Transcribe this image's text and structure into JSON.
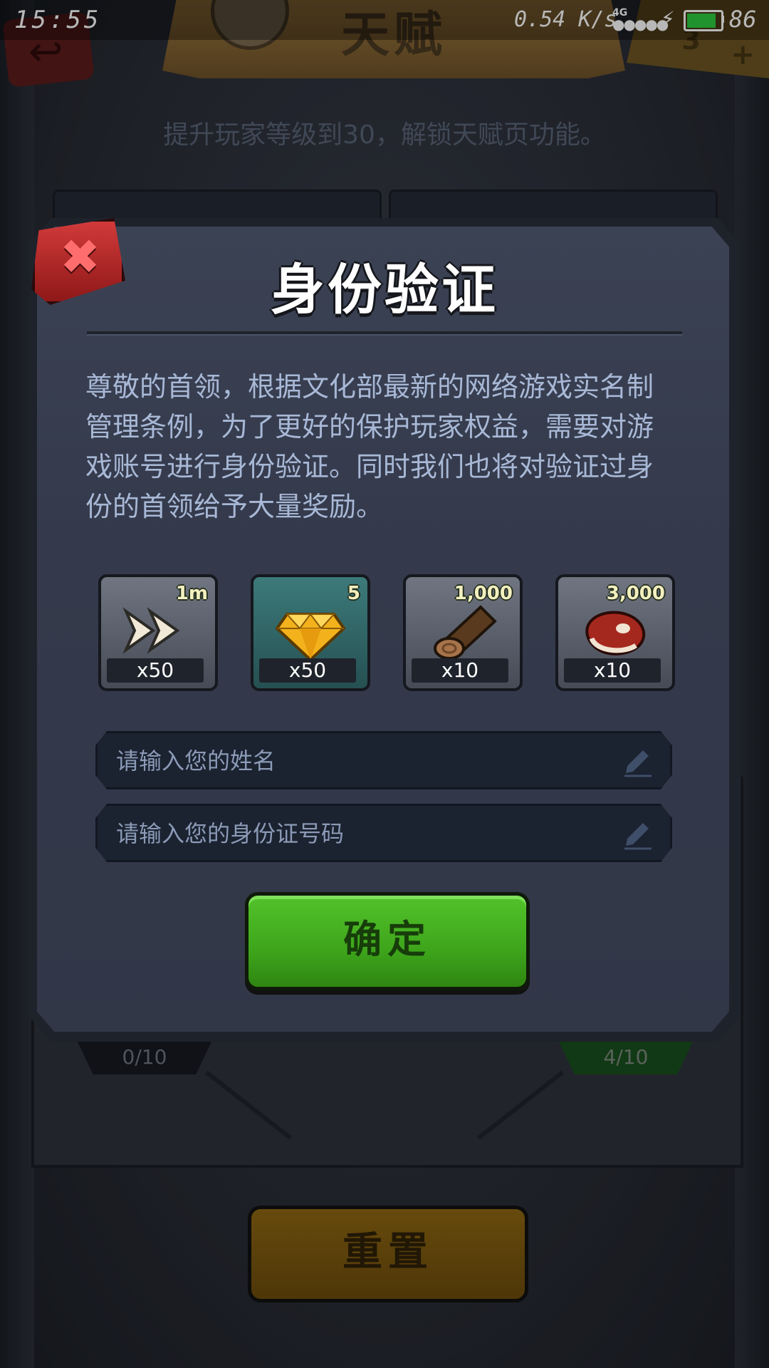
{
  "status_bar": {
    "time": "15:55",
    "network_speed": "0.54 K/s",
    "network_type": "4G",
    "battery": "86",
    "battery_level": 0.86
  },
  "background": {
    "title": "天赋",
    "key_count": "3",
    "hint": "提升玩家等级到30，解锁天赋页功能。",
    "counter_left": "0/10",
    "counter_right": "4/10",
    "reset_label": "重置"
  },
  "modal": {
    "title": "身份验证",
    "body": "尊敬的首领，根据文化部最新的网络游戏实名制管理条例，为了更好的保护玩家权益，需要对游戏账号进行身份验证。同时我们也将对验证过身份的首领给予大量奖励。",
    "rewards": [
      {
        "icon": "speedup-arrows-icon",
        "tag": "1m",
        "qty": "x50",
        "style": "grey"
      },
      {
        "icon": "gem-icon",
        "tag": "5",
        "qty": "x50",
        "style": "teal"
      },
      {
        "icon": "wood-log-icon",
        "tag": "1,000",
        "qty": "x10",
        "style": "grey"
      },
      {
        "icon": "meat-icon",
        "tag": "3,000",
        "qty": "x10",
        "style": "grey"
      }
    ],
    "name_placeholder": "请输入您的姓名",
    "id_placeholder": "请输入您的身份证号码",
    "confirm_label": "确定"
  },
  "colors": {
    "close": "#c62f2f",
    "confirm": "#44b120",
    "reset": "#8a6211",
    "panel": "#363c4d",
    "body_text": "#a8b8d6"
  }
}
